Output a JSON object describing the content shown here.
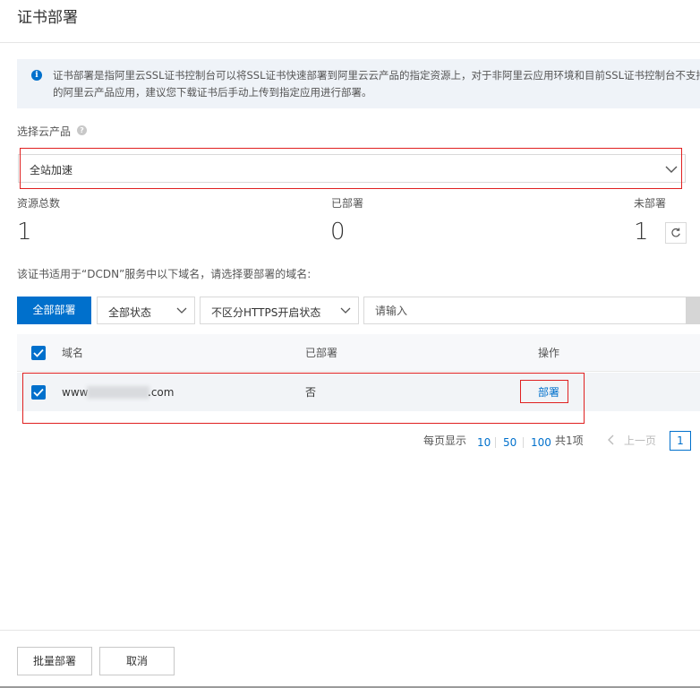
{
  "header": {
    "title": "证书部署"
  },
  "notice": {
    "text": "证书部署是指阿里云SSL证书控制台可以将SSL证书快速部署到阿里云云产品的指定资源上，对于非阿里云应用环境和目前SSL证书控制台不支持的阿里云产品应用，建议您下载证书后手动上传到指定应用进行部署。"
  },
  "product_select": {
    "label": "选择云产品",
    "value": "全站加速"
  },
  "stats": {
    "total_label": "资源总数",
    "total_value": "1",
    "deployed_label": "已部署",
    "deployed_value": "0",
    "undeployed_label": "未部署",
    "undeployed_value": "1"
  },
  "hint": "该证书适用于“DCDN”服务中以下域名，请选择要部署的域名:",
  "filters": {
    "deploy_all_label": "全部部署",
    "status_value": "全部状态",
    "https_value": "不区分HTTPS开启状态",
    "search_placeholder": "请输入"
  },
  "table": {
    "columns": [
      "域名",
      "已部署",
      "操作"
    ],
    "rows": [
      {
        "domain_prefix": "www",
        "domain_suffix": ".com",
        "deployed": "否",
        "action": "部署",
        "checked": true
      }
    ]
  },
  "pagination": {
    "per_page_label": "每页显示",
    "sizes": [
      "10",
      "50",
      "100"
    ],
    "total": "共1项",
    "prev_label": "上一页",
    "current_page": "1"
  },
  "footer": {
    "batch_deploy_label": "批量部署",
    "cancel_label": "取消"
  },
  "colors": {
    "primary": "#0070cc",
    "highlight_border": "#e02020",
    "banner_bg": "#eff3f8"
  },
  "icons": {
    "notice": "info-circle-icon",
    "help": "question-circle-icon",
    "dropdown": "chevron-down-icon",
    "refresh": "refresh-icon",
    "checkbox": "checkmark-icon",
    "prev": "chevron-left-icon"
  }
}
